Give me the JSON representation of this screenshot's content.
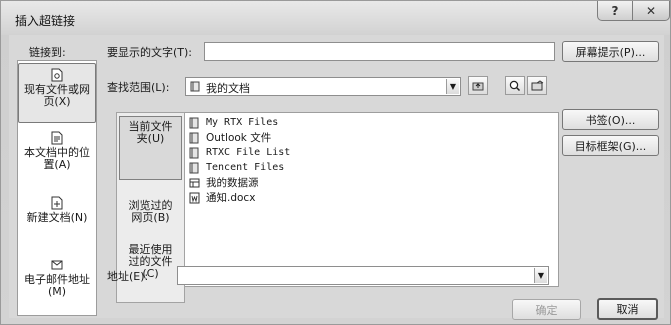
{
  "dialog": {
    "title": "插入超链接",
    "help_label": "?",
    "close_label": "✕"
  },
  "link_to": {
    "label": "链接到:",
    "items": [
      {
        "label": "现有文件或网页(X)",
        "line1": "现有文件或网",
        "line2": "页(X)",
        "icon": "existing-file-icon",
        "selected": true
      },
      {
        "label": "本文档中的位置(A)",
        "line1": "本文档中的位",
        "line2": "置(A)",
        "icon": "place-in-document-icon",
        "selected": false
      },
      {
        "label": "新建文档(N)",
        "line1": "新建文档(N)",
        "line2": "",
        "icon": "new-document-icon",
        "selected": false
      },
      {
        "label": "电子邮件地址(M)",
        "line1": "电子邮件地址",
        "line2": "(M)",
        "icon": "email-address-icon",
        "selected": false
      }
    ]
  },
  "display_text": {
    "label": "要显示的文字(T):",
    "value": ""
  },
  "screen_tip_button": "屏幕提示(P)...",
  "look_in": {
    "label": "查找范围(L):",
    "value": "我的文档",
    "folder_icon": "folder-icon"
  },
  "toolbar_icons": [
    "up-folder-icon",
    "browse-web-icon",
    "browse-file-icon"
  ],
  "subnav": {
    "items": [
      {
        "line1": "当前文件",
        "line2": "夹(U)",
        "line3": "",
        "selected": true
      },
      {
        "line1": "浏览过的",
        "line2": "网页(B)",
        "line3": "",
        "selected": false
      },
      {
        "line1": "最近使用",
        "line2": "过的文件",
        "line3": "(C)",
        "selected": false
      }
    ]
  },
  "files": [
    {
      "name": "My RTX Files",
      "icon": "folder-icon",
      "cjk": false
    },
    {
      "name": "Outlook 文件",
      "icon": "folder-icon",
      "cjk": true
    },
    {
      "name": "RTXC File List",
      "icon": "folder-icon",
      "cjk": false
    },
    {
      "name": "Tencent Files",
      "icon": "folder-icon",
      "cjk": false
    },
    {
      "name": "我的数据源",
      "icon": "data-source-icon",
      "cjk": true
    },
    {
      "name": "通知.docx",
      "icon": "word-document-icon",
      "cjk": true
    }
  ],
  "bookmark_button": "书签(O)...",
  "target_frame_button": "目标框架(G)...",
  "address": {
    "label": "地址(E):",
    "value": ""
  },
  "ok_button": "确定",
  "cancel_button": "取消"
}
